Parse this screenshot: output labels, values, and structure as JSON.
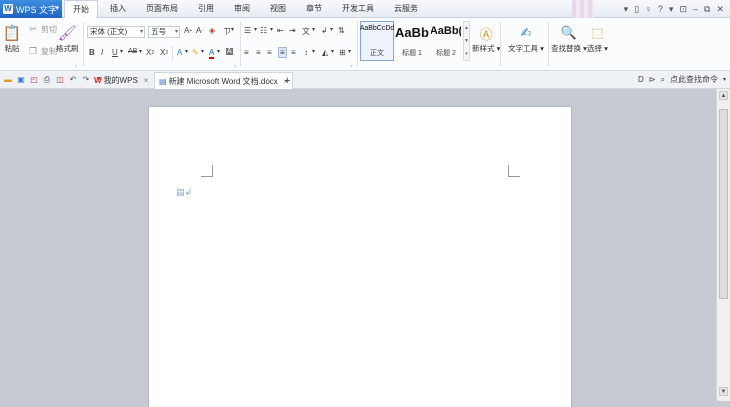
{
  "app": {
    "name": "WPS 文字",
    "logo": "W"
  },
  "menu": {
    "tabs": [
      "开始",
      "插入",
      "页面布局",
      "引用",
      "审阅",
      "视图",
      "章节",
      "开发工具",
      "云服务"
    ],
    "active": "开始"
  },
  "window_controls": [
    "▾",
    "▯",
    "♀",
    "?",
    "▾",
    "⊡",
    "–",
    "⧉",
    "✕"
  ],
  "ribbon": {
    "paste": "粘贴",
    "cut": "剪切",
    "copy": "复制",
    "format_painter": "格式刷",
    "font_name": "宋体 (正文)",
    "font_size": "五号",
    "styles": [
      {
        "sample": "AaBbCcDd",
        "label": "正文"
      },
      {
        "sample": "AaBb",
        "label": "标题 1"
      },
      {
        "sample": "AaBb(",
        "label": "标题 2"
      }
    ],
    "new_style": "新样式",
    "text_tools": "文字工具",
    "find_replace": "查找替换",
    "select": "选择"
  },
  "tabs": {
    "home_tab": "我的WPS",
    "doc_tab": "新建 Microsoft Word 文档.docx",
    "add": "+",
    "search_label": "点此查找命令"
  },
  "colors": {
    "accent": "#1f64c0",
    "page_bg": "#c6cad2"
  }
}
